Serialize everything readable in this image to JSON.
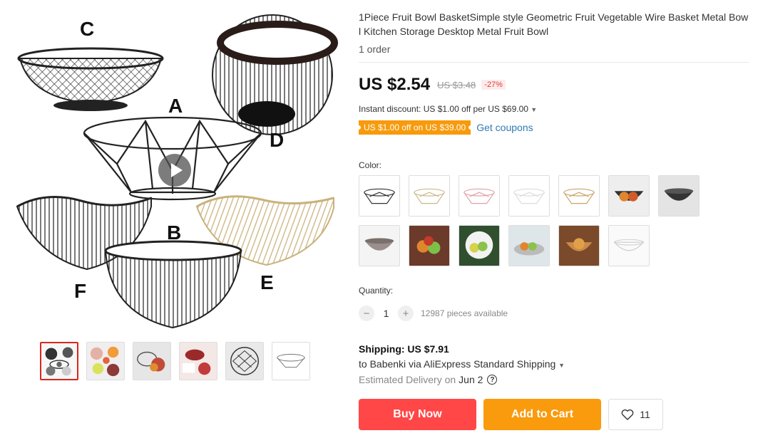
{
  "gallery": {
    "letters": [
      "C",
      "D",
      "A",
      "F",
      "B",
      "E"
    ],
    "thumbnail_count": 6
  },
  "product": {
    "title": "1Piece Fruit Bowl BasketSimple style Geometric Fruit Vegetable Wire Basket Metal Bowl Kitchen Storage Desktop Metal Fruit Bowl",
    "orders": "1 order"
  },
  "price": {
    "current": "US $2.54",
    "original": "US $3.48",
    "discount": "-27%"
  },
  "promo": {
    "instant_discount": "Instant discount: US $1.00 off per US $69.00",
    "coupon_tag": "US $1.00 off on US $39.00",
    "get_coupons": "Get coupons"
  },
  "color": {
    "label": "Color:",
    "swatch_count": 13
  },
  "quantity": {
    "label": "Quantity:",
    "value": "1",
    "minus": "−",
    "plus": "+",
    "available": "12987 pieces available"
  },
  "shipping": {
    "title": "Shipping: US $7.91",
    "route": "to Babenki via AliExpress Standard Shipping",
    "delivery_label": "Estimated Delivery on",
    "delivery_date": "Jun 2",
    "help": "?"
  },
  "actions": {
    "buy_now": "Buy Now",
    "add_to_cart": "Add to Cart",
    "wishlist_count": "11"
  },
  "colors": {
    "price_red": "#e53935",
    "buy_now": "#ff4747",
    "add_to_cart": "#fa9a0d",
    "coupon": "#f79a0c",
    "link": "#2e7bb3",
    "thumb_active_border": "#d9261c"
  }
}
